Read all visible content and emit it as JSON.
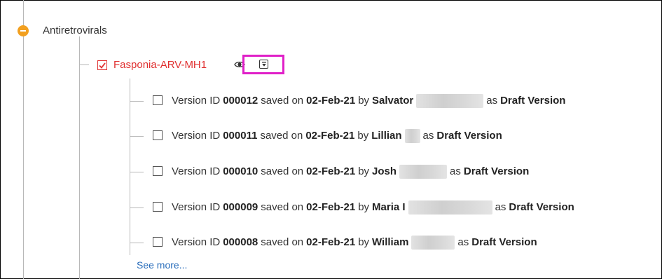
{
  "tree": {
    "group_label": "Antiretrovirals",
    "product": {
      "label": "Fasponia-ARV-MH1",
      "checked": true,
      "accent_color": "#e03030",
      "icons": [
        "eye-icon",
        "download-icon"
      ],
      "highlight_color": "#e020c8"
    },
    "versions": [
      {
        "prefix": "Version ID",
        "id": "000012",
        "saved_on": "saved on",
        "date": "02-Feb-21",
        "by": "by",
        "user": "Salvator",
        "as": "as",
        "status": "Draft Version"
      },
      {
        "prefix": "Version ID",
        "id": "000011",
        "saved_on": "saved on",
        "date": "02-Feb-21",
        "by": "by",
        "user": "Lillian",
        "as": "as",
        "status": "Draft Version"
      },
      {
        "prefix": "Version ID",
        "id": "000010",
        "saved_on": "saved on",
        "date": "02-Feb-21",
        "by": "by",
        "user": "Josh",
        "as": "as",
        "status": "Draft Version"
      },
      {
        "prefix": "Version ID",
        "id": "000009",
        "saved_on": "saved on",
        "date": "02-Feb-21",
        "by": "by",
        "user": "Maria I",
        "as": "as",
        "status": "Draft Version"
      },
      {
        "prefix": "Version ID",
        "id": "000008",
        "saved_on": "saved on",
        "date": "02-Feb-21",
        "by": "by",
        "user": "William",
        "as": "as",
        "status": "Draft Version"
      }
    ],
    "see_more_label": "See more..."
  }
}
